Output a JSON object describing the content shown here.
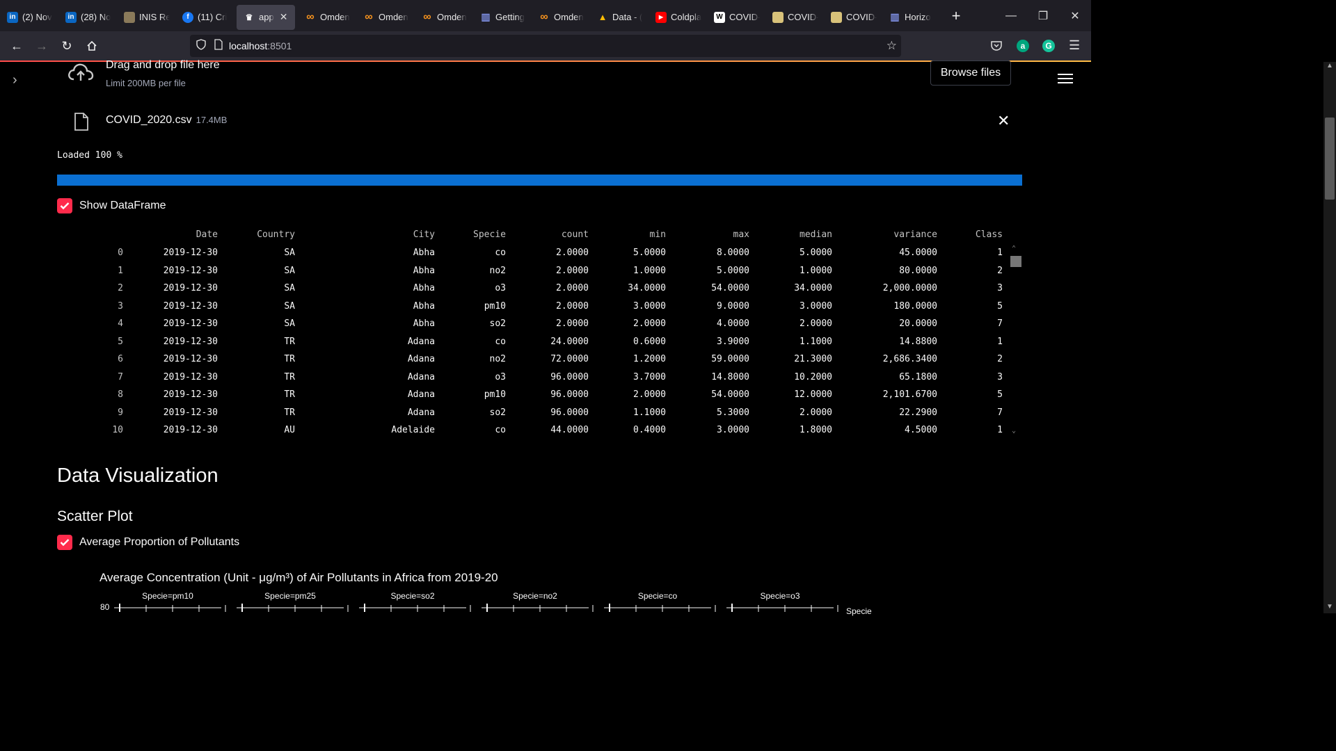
{
  "browser": {
    "tabs": [
      {
        "label": "(2) Nov",
        "icon": "linkedin-icon",
        "color": "#0a66c2"
      },
      {
        "label": "(28) No",
        "icon": "linkedin-icon",
        "color": "#0a66c2"
      },
      {
        "label": "INIS Re",
        "icon": "feather-icon",
        "color": "#8a7a5a"
      },
      {
        "label": "(11) Cri",
        "icon": "facebook-icon",
        "color": "#1877f2"
      },
      {
        "label": "app",
        "icon": "streamlit-icon",
        "color": "#ff4b4b",
        "active": true
      },
      {
        "label": "Omden",
        "icon": "omdena-icon",
        "color": "#f7931e"
      },
      {
        "label": "Omden",
        "icon": "omdena-icon",
        "color": "#f7931e"
      },
      {
        "label": "Omden",
        "icon": "omdena-icon",
        "color": "#f7931e"
      },
      {
        "label": "Getting",
        "icon": "chart-bars-icon",
        "color": "#7b8cde"
      },
      {
        "label": "Omden",
        "icon": "omdena-icon",
        "color": "#f7931e"
      },
      {
        "label": "Data - (",
        "icon": "google-drive-icon",
        "color": "#34a853"
      },
      {
        "label": "Coldpla",
        "icon": "youtube-icon",
        "color": "#ff0000"
      },
      {
        "label": "COVID-",
        "icon": "wikipedia-icon",
        "color": "#ffffff"
      },
      {
        "label": "COVID-",
        "icon": "emblem-icon",
        "color": "#d8c27a"
      },
      {
        "label": "COVID-",
        "icon": "emblem-icon",
        "color": "#d8c27a"
      },
      {
        "label": "Horizo",
        "icon": "chart-bars-icon",
        "color": "#7b8cde"
      }
    ],
    "url_host": "localhost",
    "url_port": ":8501"
  },
  "uploader": {
    "drag_text": "Drag and drop file here",
    "limit_text": "Limit 200MB per file",
    "browse_label": "Browse files",
    "file_name": "COVID_2020.csv",
    "file_size": "17.4MB"
  },
  "progress": {
    "text": "Loaded 100 %",
    "value": 1.0,
    "color": "#0a6fd1"
  },
  "show_df": {
    "label": "Show DataFrame",
    "checked": true
  },
  "dataframe": {
    "columns": [
      "",
      "Date",
      "Country",
      "City",
      "Specie",
      "count",
      "min",
      "max",
      "median",
      "variance",
      "Class"
    ],
    "rows": [
      [
        "0",
        "2019-12-30",
        "SA",
        "Abha",
        "co",
        "2.0000",
        "5.0000",
        "8.0000",
        "5.0000",
        "45.0000",
        "1"
      ],
      [
        "1",
        "2019-12-30",
        "SA",
        "Abha",
        "no2",
        "2.0000",
        "1.0000",
        "5.0000",
        "1.0000",
        "80.0000",
        "2"
      ],
      [
        "2",
        "2019-12-30",
        "SA",
        "Abha",
        "o3",
        "2.0000",
        "34.0000",
        "54.0000",
        "34.0000",
        "2,000.0000",
        "3"
      ],
      [
        "3",
        "2019-12-30",
        "SA",
        "Abha",
        "pm10",
        "2.0000",
        "3.0000",
        "9.0000",
        "3.0000",
        "180.0000",
        "5"
      ],
      [
        "4",
        "2019-12-30",
        "SA",
        "Abha",
        "so2",
        "2.0000",
        "2.0000",
        "4.0000",
        "2.0000",
        "20.0000",
        "7"
      ],
      [
        "5",
        "2019-12-30",
        "TR",
        "Adana",
        "co",
        "24.0000",
        "0.6000",
        "3.9000",
        "1.1000",
        "14.8800",
        "1"
      ],
      [
        "6",
        "2019-12-30",
        "TR",
        "Adana",
        "no2",
        "72.0000",
        "1.2000",
        "59.0000",
        "21.3000",
        "2,686.3400",
        "2"
      ],
      [
        "7",
        "2019-12-30",
        "TR",
        "Adana",
        "o3",
        "96.0000",
        "3.7000",
        "14.8000",
        "10.2000",
        "65.1800",
        "3"
      ],
      [
        "8",
        "2019-12-30",
        "TR",
        "Adana",
        "pm10",
        "96.0000",
        "2.0000",
        "54.0000",
        "12.0000",
        "2,101.6700",
        "5"
      ],
      [
        "9",
        "2019-12-30",
        "TR",
        "Adana",
        "so2",
        "96.0000",
        "1.1000",
        "5.3000",
        "2.0000",
        "22.2900",
        "7"
      ],
      [
        "10",
        "2019-12-30",
        "AU",
        "Adelaide",
        "co",
        "44.0000",
        "0.4000",
        "3.0000",
        "1.8000",
        "4.5000",
        "1"
      ]
    ]
  },
  "headings": {
    "data_viz": "Data Visualization",
    "scatter": "Scatter Plot"
  },
  "avg_pollutants": {
    "label": "Average Proportion of Pollutants",
    "checked": true
  },
  "chart": {
    "title": "Average Concentration (Unit - μg/m³) of Air Pollutants in Africa from 2019-20",
    "facets": [
      "Specie=pm10",
      "Specie=pm25",
      "Specie=so2",
      "Specie=no2",
      "Specie=co",
      "Specie=o3"
    ],
    "ytick_top": "80",
    "legend_title": "Specie"
  },
  "chart_data": {
    "type": "scatter",
    "title": "Average Concentration (Unit - μg/m³) of Air Pollutants in Africa from 2019-20",
    "facets": [
      "Specie=pm10",
      "Specie=pm25",
      "Specie=so2",
      "Specie=no2",
      "Specie=co",
      "Specie=o3"
    ],
    "yticks_visible": [
      "80"
    ],
    "legend_title": "Specie"
  },
  "colors": {
    "accent": "#ff2b4b",
    "background": "#000000",
    "text": "#fafafa"
  }
}
